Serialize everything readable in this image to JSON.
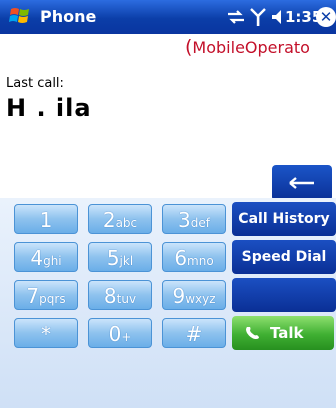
{
  "titlebar": {
    "app_title": "Phone",
    "time": "1:35",
    "close_glyph": "✕",
    "icons": [
      "windows-start-icon",
      "connectivity-icon",
      "signal-icon",
      "volume-icon",
      "close-icon"
    ]
  },
  "operator": {
    "paren": "(",
    "name": "MobileOperato"
  },
  "last_call": {
    "label": "Last call:",
    "name": "H . ila"
  },
  "keypad": {
    "keys": [
      {
        "digit": "1",
        "letters": ""
      },
      {
        "digit": "2",
        "letters": "abc"
      },
      {
        "digit": "3",
        "letters": "def"
      },
      {
        "digit": "4",
        "letters": "ghi"
      },
      {
        "digit": "5",
        "letters": "jkl"
      },
      {
        "digit": "6",
        "letters": "mno"
      },
      {
        "digit": "7",
        "letters": "pqrs"
      },
      {
        "digit": "8",
        "letters": "tuv"
      },
      {
        "digit": "9",
        "letters": "wxyz"
      },
      {
        "digit": "*",
        "letters": ""
      },
      {
        "digit": "0",
        "letters": "+"
      },
      {
        "digit": "#",
        "letters": ""
      }
    ],
    "call_history": "Call History",
    "speed_dial": "Speed Dial",
    "talk": "Talk"
  },
  "colors": {
    "titlebar": "#0b3ea8",
    "operator_text": "#c3102a",
    "key_blue": "#8ec2ee",
    "fn_blue": "#0a2f95",
    "talk_green": "#3faf32"
  }
}
